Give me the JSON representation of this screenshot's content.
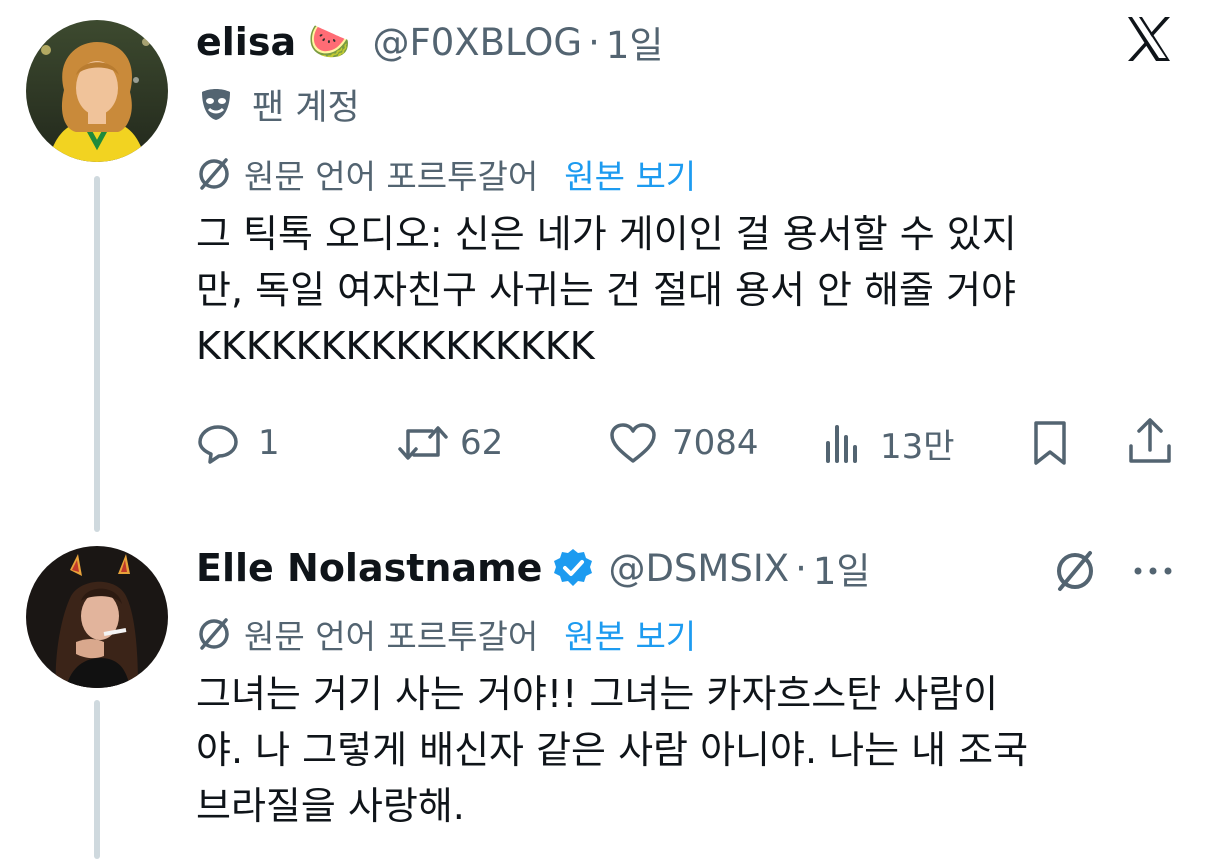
{
  "tweets": [
    {
      "display_name": "elisa",
      "emoji": "🍉",
      "handle": "@F0XBLOG",
      "time": "1일",
      "badge_label": "팬 계정",
      "translation_note": "원문 언어 포르투갈어",
      "translation_link": "원본 보기",
      "text_lines": [
        "그 틱톡 오디오: 신은 네가 게이인 걸 용서할 수 있지",
        "만, 독일 여자친구 사귀는 건 절대 용서 안 해줄 거야",
        "KKKKKKKKKKKKKKKK"
      ],
      "stats": {
        "replies": "1",
        "retweets": "62",
        "likes": "7084",
        "views": "13만"
      }
    },
    {
      "display_name": "Elle Nolastname",
      "verified": true,
      "handle": "@DSMSIX",
      "time": "1일",
      "translation_note": "원문 언어 포르투갈어",
      "translation_link": "원본 보기",
      "text_lines": [
        "그녀는 거기 사는 거야!! 그녀는 카자흐스탄 사람이",
        "야. 나 그렇게 배신자 같은 사람 아니야. 나는 내 조국",
        "브라질을 사랑해."
      ]
    }
  ],
  "icons": {
    "logo": "x-logo-icon",
    "fan_badge": "theater-mask-icon",
    "translate": "translate-globe-icon",
    "reply": "reply-icon",
    "retweet": "retweet-icon",
    "like": "heart-icon",
    "views": "views-bar-chart-icon",
    "bookmark": "bookmark-icon",
    "share": "share-icon",
    "more": "more-options-icon",
    "verified": "verified-badge-icon"
  },
  "colors": {
    "link": "#1d9bf0",
    "muted": "#536471",
    "text": "#0f1419",
    "verified": "#1d9bf0"
  }
}
